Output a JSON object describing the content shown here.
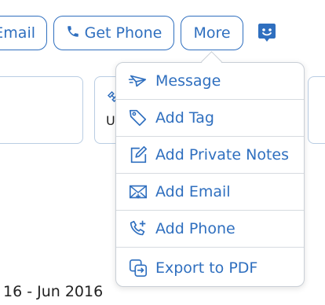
{
  "toolbar": {
    "email_label": "Email",
    "phone_label": "Get Phone",
    "more_label": "More",
    "accent_color": "#2f6fbf"
  },
  "cards": {
    "mid_text": "U"
  },
  "date_range": "16 - Jun 2016",
  "menu": {
    "items": [
      {
        "label": "Message",
        "icon": "paper-plane-icon"
      },
      {
        "label": "Add Tag",
        "icon": "tag-icon"
      },
      {
        "label": "Add Private Notes",
        "icon": "edit-note-icon"
      },
      {
        "label": "Add Email",
        "icon": "envelope-plus-icon"
      },
      {
        "label": "Add Phone",
        "icon": "phone-plus-icon"
      },
      {
        "label": "Export to PDF",
        "icon": "export-icon"
      }
    ]
  }
}
